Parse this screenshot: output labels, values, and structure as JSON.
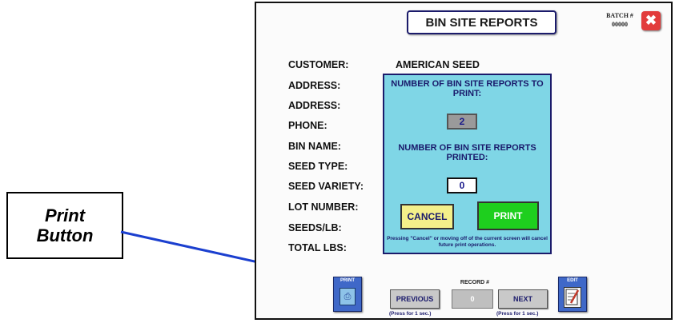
{
  "callout": {
    "line1": "Print",
    "line2": "Button"
  },
  "header": {
    "title": "BIN SITE REPORTS",
    "batch_label": "BATCH #",
    "batch_number": "00000",
    "close_glyph": "✖"
  },
  "fields": [
    {
      "label": "CUSTOMER:"
    },
    {
      "label": "ADDRESS:"
    },
    {
      "label": "ADDRESS:"
    },
    {
      "label": "PHONE:"
    },
    {
      "label": "BIN NAME:"
    },
    {
      "label": "SEED TYPE:"
    },
    {
      "label": "SEED VARIETY:"
    },
    {
      "label": "LOT NUMBER:"
    },
    {
      "label": "SEEDS/LB:"
    },
    {
      "label": "TOTAL LBS:"
    }
  ],
  "customer_value": "AMERICAN SEED",
  "dialog": {
    "to_print_heading": "NUMBER OF BIN SITE REPORTS TO PRINT:",
    "to_print_value": "2",
    "printed_heading": "NUMBER OF BIN SITE REPORTS PRINTED:",
    "printed_value": "0",
    "cancel_label": "CANCEL",
    "print_label": "PRINT",
    "note": "Pressing \"Cancel\" or moving off of the current screen will cancel future print operations."
  },
  "bottom": {
    "print_label": "PRINT",
    "record_label": "RECORD #",
    "previous_label": "PREVIOUS",
    "record_value": "0",
    "next_label": "NEXT",
    "press_note": "(Press for 1 sec.)",
    "edit_label": "EDIT"
  },
  "colors": {
    "dialog_bg": "#7fd6e6",
    "print_green": "#1ecf1e",
    "cancel_yellow": "#f4f08a",
    "arrow_blue": "#1b3fcf",
    "close_red": "#e23b3b"
  },
  "icons": [
    "close-icon",
    "printer-icon",
    "edit-icon"
  ]
}
